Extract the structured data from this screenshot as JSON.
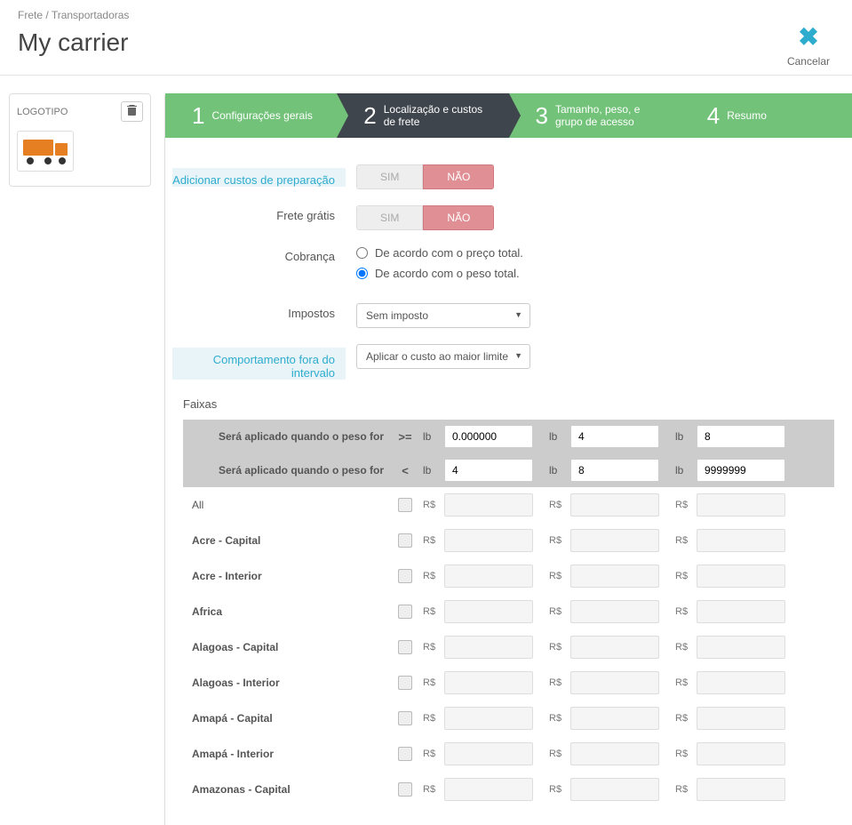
{
  "breadcrumb": {
    "root": "Frete",
    "sep": "/",
    "current": "Transportadoras"
  },
  "page_title": "My carrier",
  "cancel": "Cancelar",
  "logo_panel": {
    "title": "LOGOTIPO"
  },
  "steps": [
    {
      "num": "1",
      "label": "Configurações gerais"
    },
    {
      "num": "2",
      "label": "Localização e custos de frete"
    },
    {
      "num": "3",
      "label": "Tamanho, peso, e grupo de acesso"
    },
    {
      "num": "4",
      "label": "Resumo"
    }
  ],
  "form": {
    "add_handling_label": "Adicionar custos de preparação",
    "free_shipping_label": "Frete grátis",
    "toggle": {
      "yes": "SIM",
      "no": "NÃO"
    },
    "billing_label": "Cobrança",
    "billing_price": "De acordo com o preço total.",
    "billing_weight": "De acordo com o peso total.",
    "tax_label": "Impostos",
    "tax_value": "Sem imposto",
    "oor_label": "Comportamento fora do intervalo",
    "oor_value": "Aplicar o custo ao maior limite"
  },
  "ranges": {
    "title": "Faixas",
    "row_ge": "Será aplicado quando o peso for",
    "op_ge": ">=",
    "row_lt": "Será aplicado quando o peso for",
    "op_lt": "<",
    "unit": "lb",
    "ge_values": [
      "0.000000",
      "4",
      "8"
    ],
    "lt_values": [
      "4",
      "8",
      "9999999"
    ]
  },
  "currency": "R$",
  "zones": [
    {
      "name": "All",
      "bold": false
    },
    {
      "name": "Acre - Capital",
      "bold": true
    },
    {
      "name": "Acre - Interior",
      "bold": true
    },
    {
      "name": "Africa",
      "bold": true
    },
    {
      "name": "Alagoas - Capital",
      "bold": true
    },
    {
      "name": "Alagoas - Interior",
      "bold": true
    },
    {
      "name": "Amapá - Capital",
      "bold": true
    },
    {
      "name": "Amapá - Interior",
      "bold": true
    },
    {
      "name": "Amazonas - Capital",
      "bold": true
    }
  ]
}
